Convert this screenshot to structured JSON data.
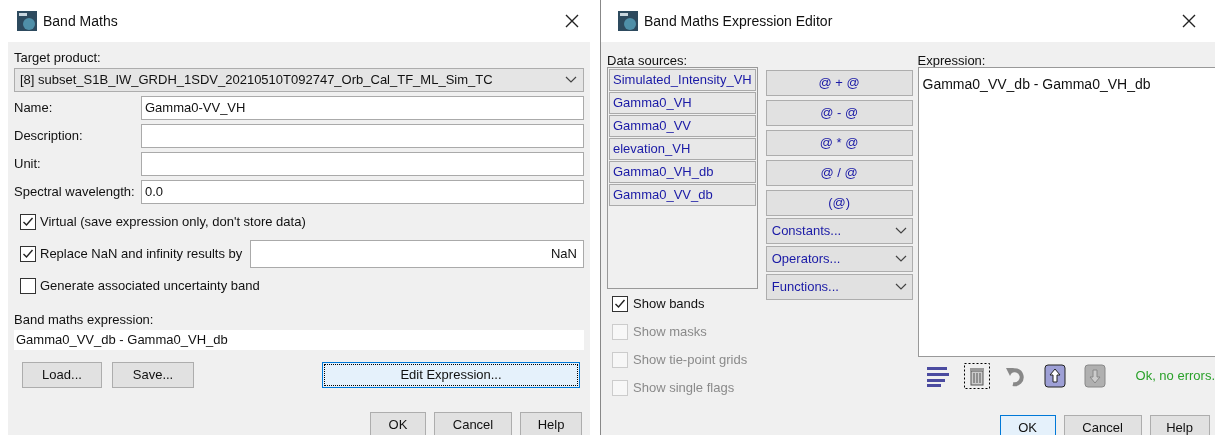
{
  "band_maths": {
    "title": "Band Maths",
    "target_product_label": "Target product:",
    "target_product": "[8] subset_S1B_IW_GRDH_1SDV_20210510T092747_Orb_Cal_TF_ML_Sim_TC",
    "fields": [
      {
        "label": "Name:",
        "value": "Gamma0-VV_VH"
      },
      {
        "label": "Description:"
      },
      {
        "label": "Unit:"
      },
      {
        "label": "Spectral wavelength:",
        "value": "0.0"
      }
    ],
    "options": [
      {
        "kind": "checkbox",
        "label": "Virtual (save expression only, don't store data)",
        "checked": true
      },
      {
        "kind": "checkbox_field",
        "label": "Replace NaN and infinity results by",
        "checked": true,
        "value": "NaN"
      },
      {
        "kind": "checkbox",
        "label": "Generate associated uncertainty band",
        "checked": false
      }
    ],
    "expression_label": "Band maths expression:",
    "expression": "Gamma0_VV_db - Gamma0_VH_db",
    "file_buttons": [
      "Load...",
      "Save..."
    ],
    "edit_button": {
      "label": "Edit Expression...",
      "focused": true
    },
    "buttons": [
      {
        "label": "OK",
        "default": false
      },
      {
        "label": "Cancel",
        "default": false
      },
      {
        "label": "Help",
        "default": false
      }
    ]
  },
  "expression_editor": {
    "title": "Band Maths Expression Editor",
    "data_sources_label": "Data sources:",
    "data_sources": [
      "Simulated_Intensity_VH",
      "Gamma0_VH",
      "Gamma0_VV",
      "elevation_VH",
      "Gamma0_VH_db",
      "Gamma0_VV_db"
    ],
    "operator_buttons": [
      "@ + @",
      "@ - @",
      "@ * @",
      "@ / @",
      "(@)"
    ],
    "menus": [
      "Constants...",
      "Operators...",
      "Functions..."
    ],
    "filters": [
      {
        "label": "Show bands",
        "checked": true,
        "disabled": false
      },
      {
        "label": "Show masks",
        "checked": false,
        "disabled": true
      },
      {
        "label": "Show tie-point grids",
        "checked": false,
        "disabled": true
      },
      {
        "label": "Show single flags",
        "checked": false,
        "disabled": true
      }
    ],
    "expression_label": "Expression:",
    "expression": "Gamma0_VV_db - Gamma0_VH_db",
    "status": "Ok, no errors.",
    "buttons": [
      {
        "label": "OK",
        "default": true
      },
      {
        "label": "Cancel",
        "default": false
      },
      {
        "label": "Help",
        "default": false
      }
    ]
  }
}
